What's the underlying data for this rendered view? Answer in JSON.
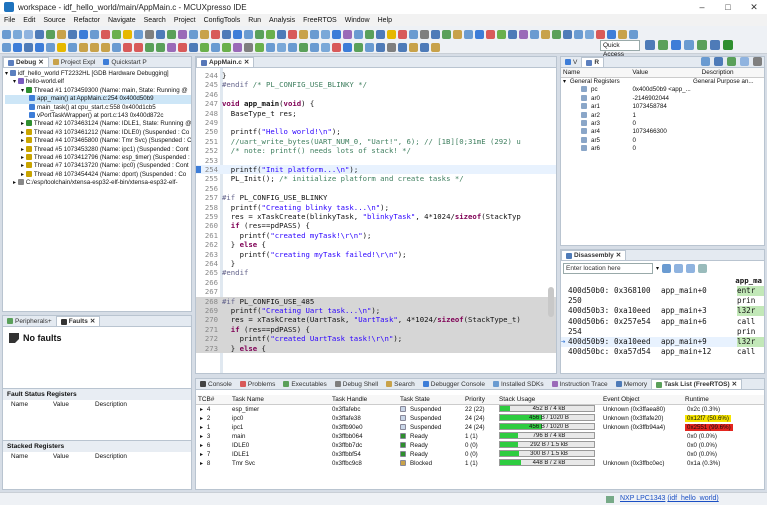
{
  "window": {
    "title": "workspace - idf_hello_world/main/AppMain.c - MCUXpresso IDE"
  },
  "menu": [
    "File",
    "Edit",
    "Source",
    "Refactor",
    "Navigate",
    "Search",
    "Project",
    "ConfigTools",
    "Run",
    "Analysis",
    "FreeRTOS",
    "Window",
    "Help"
  ],
  "quick_access": "Quick Access",
  "debug_view": {
    "tabs": [
      "Debug",
      "Project Expl",
      "Quickstart P"
    ],
    "tree": [
      {
        "t": "idf_hello_world FT2232HL [GDB Hardware Debugging]",
        "lvl": 0,
        "i": "#5b7fbf"
      },
      {
        "t": "hello-world.elf",
        "lvl": 1,
        "i": "#7a5bbf"
      },
      {
        "t": "Thread #1 1073459300 (Name: main, State: Running @",
        "lvl": 2,
        "i": "#2f8f2f"
      },
      {
        "t": "app_main() at AppMain.c:254 0x400d50b9",
        "lvl": 3,
        "i": "#3d7dd8",
        "sel": true
      },
      {
        "t": "main_task() at cpu_start.c:558 0x400d1cb5",
        "lvl": 3,
        "i": "#3d7dd8"
      },
      {
        "t": "vPortTaskWrapper() at port.c:143 0x400d872c",
        "lvl": 3,
        "i": "#3d7dd8"
      },
      {
        "t": "Thread #2 1073463124 (Name: IDLE1, State: Running @",
        "lvl": 2,
        "i": "#2f8f2f"
      },
      {
        "t": "Thread #3 1073461212 (Name: IDLE0) (Suspended : Co",
        "lvl": 2,
        "i": "#c9a400"
      },
      {
        "t": "Thread #4 1073465800 (Name: Tmr Svc) (Suspended : C",
        "lvl": 2,
        "i": "#c9a400"
      },
      {
        "t": "Thread #5 1073453280 (Name: ipc1) (Suspended : Cont",
        "lvl": 2,
        "i": "#c9a400"
      },
      {
        "t": "Thread #6 1073412796 (Name: esp_timer) (Suspended : C",
        "lvl": 2,
        "i": "#c9a400"
      },
      {
        "t": "Thread #7 1073413720 (Name: ipc0) (Suspended : Cont",
        "lvl": 2,
        "i": "#c9a400"
      },
      {
        "t": "Thread #8 1073454424 (Name: dport) (Suspended : Co",
        "lvl": 2,
        "i": "#c9a400"
      },
      {
        "t": "C:/esp/toolchain/xtensa-esp32-elf-bin/xtensa-esp32-elf-",
        "lvl": 1,
        "i": "#888888"
      }
    ]
  },
  "faults_view": {
    "tabs": [
      "Peripherals+",
      "Faults"
    ],
    "heading": "No faults",
    "fsr_title": "Fault Status Registers",
    "sr_title": "Stacked Registers",
    "cols": [
      "Name",
      "Value",
      "Description"
    ]
  },
  "editor": {
    "tab": "AppMain.c",
    "lines": [
      {
        "n": "244",
        "h": "}",
        "hl": ""
      },
      {
        "n": "245",
        "h": "<span class=\"mc\">#endif</span> <span class=\"cm\">/* PL_CONFIG_USE_BLINKY */</span>",
        "hl": ""
      },
      {
        "n": "246",
        "h": "",
        "hl": ""
      },
      {
        "n": "247",
        "h": "<span class=\"kw\">void</span> <b>app_main</b>(<span class=\"kw\">void</span>) {",
        "hl": ""
      },
      {
        "n": "248",
        "h": "  BaseType_t res;",
        "hl": ""
      },
      {
        "n": "249",
        "h": "",
        "hl": ""
      },
      {
        "n": "250",
        "h": "  printf(<span class=\"str\">\"Hello world!\\n\"</span>);",
        "hl": ""
      },
      {
        "n": "251",
        "h": "  <span class=\"cm\">//uart_write_bytes(UART_NUM_0, \"Uart!\", 6); // [1B][0;31mE (292) u</span>",
        "hl": ""
      },
      {
        "n": "252",
        "h": "  <span class=\"cm\">/* note: printf() needs lots of stack! */</span>",
        "hl": ""
      },
      {
        "n": "253",
        "h": "",
        "hl": ""
      },
      {
        "n": "254",
        "h": "  printf(<span class=\"str\">\"Init platform...\\n\"</span>);",
        "hl": "cur"
      },
      {
        "n": "255",
        "h": "  PL_Init(); <span class=\"cm\">/* initialize platform and create tasks */</span>",
        "hl": ""
      },
      {
        "n": "256",
        "h": "",
        "hl": ""
      },
      {
        "n": "257",
        "h": "<span class=\"mc\">#if</span> PL_CONFIG_USE_BLINKY",
        "hl": ""
      },
      {
        "n": "258",
        "h": "  printf(<span class=\"str\">\"Creating blinky task...\\n\"</span>);",
        "hl": ""
      },
      {
        "n": "259",
        "h": "  res = xTaskCreate(blinkyTask, <span class=\"str\">\"blinkyTask\"</span>, 4*1024/<span class=\"kw\">sizeof</span>(StackTyp",
        "hl": ""
      },
      {
        "n": "260",
        "h": "  <span class=\"kw\">if</span> (res==pdPASS) {",
        "hl": ""
      },
      {
        "n": "261",
        "h": "    printf(<span class=\"str\">\"created myTask!\\r\\n\"</span>);",
        "hl": ""
      },
      {
        "n": "262",
        "h": "  } <span class=\"kw\">else</span> {",
        "hl": ""
      },
      {
        "n": "263",
        "h": "    printf(<span class=\"str\">\"creating myTask failed!\\r\\n\"</span>);",
        "hl": ""
      },
      {
        "n": "264",
        "h": "  }",
        "hl": ""
      },
      {
        "n": "265",
        "h": "<span class=\"mc\">#endif</span>",
        "hl": ""
      },
      {
        "n": "266",
        "h": "",
        "hl": ""
      },
      {
        "n": "267",
        "h": "",
        "hl": ""
      },
      {
        "n": "268",
        "h": "<span class=\"mc\">#if</span> PL_CONFIG_USE_485",
        "hl": "grey"
      },
      {
        "n": "269",
        "h": "  printf(<span class=\"str\">\"Creating Uart task...\\n\"</span>);",
        "hl": "grey"
      },
      {
        "n": "270",
        "h": "  res = xTaskCreate(UartTask, <span class=\"str\">\"UartTask\"</span>, 4*1024/<span class=\"kw\">sizeof</span>(StackType_t)",
        "hl": "grey"
      },
      {
        "n": "271",
        "h": "  <span class=\"kw\">if</span> (res==pdPASS) {",
        "hl": "grey"
      },
      {
        "n": "272",
        "h": "    printf(<span class=\"str\">\"created UartTask task!\\r\\n\"</span>);",
        "hl": "grey"
      },
      {
        "n": "273",
        "h": "  } <span class=\"kw\">else</span> {",
        "hl": "grey"
      }
    ]
  },
  "registers": {
    "tabs": [
      "V",
      "R"
    ],
    "cols": [
      "Name",
      "Value",
      "Description"
    ],
    "group": "General Registers",
    "group_desc": "General Purpose an...",
    "rows": [
      {
        "n": "pc",
        "v": "0x400d50b9 <app_...",
        "d": ""
      },
      {
        "n": "ar0",
        "v": "-2146902044",
        "d": ""
      },
      {
        "n": "ar1",
        "v": "1073458784",
        "d": ""
      },
      {
        "n": "ar2",
        "v": "1",
        "d": ""
      },
      {
        "n": "ar3",
        "v": "0",
        "d": ""
      },
      {
        "n": "ar4",
        "v": "1073466300",
        "d": ""
      },
      {
        "n": "ar5",
        "v": "0",
        "d": ""
      },
      {
        "n": "ar6",
        "v": "0",
        "d": ""
      }
    ]
  },
  "disassembly": {
    "tab": "Disassembly",
    "placeholder": "Enter location here",
    "header": "app_ma",
    "rows": [
      {
        "a": "400d50b0:",
        "o": "0x368100",
        "s": "app_main+0",
        "r": "entr",
        "hl": true
      },
      {
        "a": "250",
        "o": "",
        "s": "",
        "r": "prin",
        "hl": false
      },
      {
        "a": "400d50b3:",
        "o": "0xa10eed",
        "s": "app_main+3",
        "r": "l32r",
        "hl": true
      },
      {
        "a": "400d50b6:",
        "o": "0x257e54",
        "s": "app_main+6",
        "r": "call",
        "hl": false
      },
      {
        "a": "254",
        "o": "",
        "s": "",
        "r": "prin",
        "hl": false
      },
      {
        "a": "400d50b9:",
        "o": "0xa10eed",
        "s": "app_main+9",
        "r": "l32r",
        "hl": true
      },
      {
        "a": "400d50bc:",
        "o": "0xa57d54",
        "s": "app_main+12",
        "r": "call",
        "hl": false
      }
    ]
  },
  "bottom": {
    "tabs": [
      "Console",
      "Problems",
      "Executables",
      "Debug Shell",
      "Search",
      "Debugger Console",
      "Installed SDKs",
      "Instruction Trace",
      "Memory",
      "Task List (FreeRTOS)"
    ],
    "cols": [
      "TCB#",
      "Task Name",
      "Task Handle",
      "Task State",
      "Priority",
      "Stack Usage",
      "Event Object",
      "Runtime"
    ],
    "rows": [
      {
        "tcb": "4",
        "name": "esp_timer",
        "handle": "0x3ffafebc",
        "state": "Suspended",
        "prio": "22 (22)",
        "stack": "452 B / 4 kB",
        "frac": 0.11,
        "evt": "Unknown (0x3ffaea80)",
        "rt": "0x2c (0.3%)",
        "rtc": ""
      },
      {
        "tcb": "2",
        "name": "ipc0",
        "handle": "0x3ffafe38",
        "state": "Suspended",
        "prio": "24 (24)",
        "stack": "456 B / 1020 B",
        "frac": 0.45,
        "evt": "Unknown (0x3ffafe20)",
        "rt": "0x12f7 (50.6%)",
        "rtc": "#f7e600"
      },
      {
        "tcb": "1",
        "name": "ipc1",
        "handle": "0x3ffb90e0",
        "state": "Suspended",
        "prio": "24 (24)",
        "stack": "456 B / 1020 B",
        "frac": 0.45,
        "evt": "Unknown (0x3ffb94a4)",
        "rt": "0x2551 (99.6%)",
        "rtc": "#e5261f"
      },
      {
        "tcb": "3",
        "name": "main",
        "handle": "0x3ffbb064",
        "state": "Ready",
        "prio": "1 (1)",
        "stack": "796 B / 4 kB",
        "frac": 0.19,
        "evt": "",
        "rt": "0x0 (0.0%)",
        "rtc": ""
      },
      {
        "tcb": "6",
        "name": "IDLE0",
        "handle": "0x3ffbb7dc",
        "state": "Ready",
        "prio": "0 (0)",
        "stack": "292 B / 1.5 kB",
        "frac": 0.19,
        "evt": "",
        "rt": "0x0 (0.0%)",
        "rtc": ""
      },
      {
        "tcb": "7",
        "name": "IDLE1",
        "handle": "0x3ffbbf54",
        "state": "Ready",
        "prio": "0 (0)",
        "stack": "300 B / 1.5 kB",
        "frac": 0.2,
        "evt": "",
        "rt": "0x0 (0.0%)",
        "rtc": ""
      },
      {
        "tcb": "8",
        "name": "Tmr Svc",
        "handle": "0x3ffbc9c8",
        "state": "Blocked",
        "prio": "1 (1)",
        "stack": "448 B / 2 kB",
        "frac": 0.22,
        "evt": "Unknown (0x3ffbc0ec)",
        "rt": "0x1a (0.3%)",
        "rtc": ""
      }
    ]
  },
  "status": {
    "link_prefix": "NXP LPC1343",
    "link_proj": "(idf_hello_world)"
  }
}
